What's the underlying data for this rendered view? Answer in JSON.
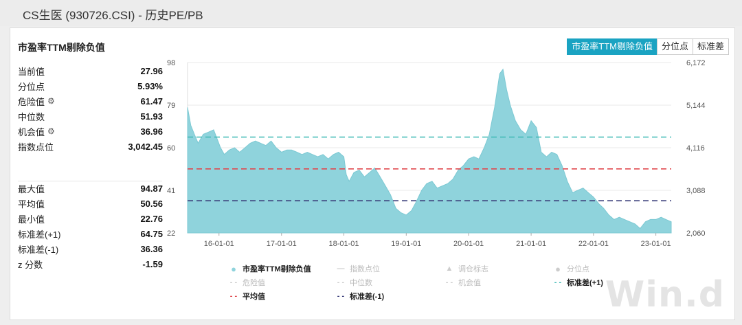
{
  "window": {
    "title": "CS生医 (930726.CSI) - 历史PE/PB"
  },
  "panel": {
    "title": "市盈率TTM剔除负值"
  },
  "tabs": [
    {
      "label": "市盈率TTM剔除负值",
      "active": true
    },
    {
      "label": "分位点",
      "active": false
    },
    {
      "label": "标准差",
      "active": false
    }
  ],
  "stats_top": [
    {
      "label": "当前值",
      "value": "27.96",
      "gear": false
    },
    {
      "label": "分位点",
      "value": "5.93%",
      "gear": false
    },
    {
      "label": "危险值",
      "value": "61.47",
      "gear": true
    },
    {
      "label": "中位数",
      "value": "51.93",
      "gear": false
    },
    {
      "label": "机会值",
      "value": "36.96",
      "gear": true
    },
    {
      "label": "指数点位",
      "value": "3,042.45",
      "gear": false
    }
  ],
  "stats_bottom": [
    {
      "label": "最大值",
      "value": "94.87"
    },
    {
      "label": "平均值",
      "value": "50.56"
    },
    {
      "label": "最小值",
      "value": "22.76"
    },
    {
      "label": "标准差(+1)",
      "value": "64.75"
    },
    {
      "label": "标准差(-1)",
      "value": "36.36"
    },
    {
      "label": "z 分数",
      "value": "-1.59"
    }
  ],
  "icons": {
    "gear": "gear-icon"
  },
  "watermark": "Win.d",
  "chart_data": {
    "type": "area",
    "x_start": "2015-07-01",
    "x_end": "2023-04-01",
    "xticks": [
      "16-01-01",
      "17-01-01",
      "18-01-01",
      "19-01-01",
      "20-01-01",
      "21-01-01",
      "22-01-01",
      "23-01-01"
    ],
    "xtick_dates": [
      "2016-01-01",
      "2017-01-01",
      "2018-01-01",
      "2019-01-01",
      "2020-01-01",
      "2021-01-01",
      "2022-01-01",
      "2023-01-01"
    ],
    "y_left": {
      "ticks": [
        "98",
        "79",
        "60",
        "41",
        "22"
      ],
      "range": [
        22,
        98
      ]
    },
    "y_right": {
      "ticks": [
        "6,172",
        "5,144",
        "4,116",
        "3,088",
        "2,060"
      ],
      "range": [
        2060,
        6172
      ]
    },
    "series": [
      {
        "name": "市盈率TTM剔除负值",
        "color": "#8fd3dc",
        "points": [
          [
            "2015-07-01",
            78
          ],
          [
            "2015-07-20",
            70
          ],
          [
            "2015-08-10",
            66
          ],
          [
            "2015-09-01",
            62
          ],
          [
            "2015-10-01",
            66
          ],
          [
            "2015-11-01",
            67
          ],
          [
            "2015-12-01",
            68
          ],
          [
            "2016-01-10",
            60
          ],
          [
            "2016-02-01",
            57
          ],
          [
            "2016-03-01",
            59
          ],
          [
            "2016-04-01",
            60
          ],
          [
            "2016-05-01",
            58
          ],
          [
            "2016-06-01",
            60
          ],
          [
            "2016-07-01",
            62
          ],
          [
            "2016-08-01",
            63
          ],
          [
            "2016-09-01",
            62
          ],
          [
            "2016-10-01",
            61
          ],
          [
            "2016-11-01",
            63
          ],
          [
            "2016-12-01",
            60
          ],
          [
            "2017-01-01",
            58
          ],
          [
            "2017-02-01",
            59
          ],
          [
            "2017-03-01",
            59
          ],
          [
            "2017-04-01",
            58
          ],
          [
            "2017-05-01",
            57
          ],
          [
            "2017-06-01",
            58
          ],
          [
            "2017-07-01",
            57
          ],
          [
            "2017-08-01",
            56
          ],
          [
            "2017-09-01",
            57
          ],
          [
            "2017-10-01",
            55
          ],
          [
            "2017-11-01",
            57
          ],
          [
            "2017-12-01",
            58
          ],
          [
            "2018-01-01",
            56
          ],
          [
            "2018-01-15",
            48
          ],
          [
            "2018-02-01",
            45
          ],
          [
            "2018-03-01",
            49
          ],
          [
            "2018-04-01",
            50
          ],
          [
            "2018-05-01",
            47
          ],
          [
            "2018-06-01",
            49
          ],
          [
            "2018-07-01",
            51
          ],
          [
            "2018-08-01",
            47
          ],
          [
            "2018-09-01",
            43
          ],
          [
            "2018-10-01",
            39
          ],
          [
            "2018-11-01",
            33
          ],
          [
            "2018-12-01",
            31
          ],
          [
            "2019-01-01",
            30
          ],
          [
            "2019-02-01",
            32
          ],
          [
            "2019-03-01",
            36
          ],
          [
            "2019-04-01",
            41
          ],
          [
            "2019-05-01",
            44
          ],
          [
            "2019-06-01",
            45
          ],
          [
            "2019-07-01",
            42
          ],
          [
            "2019-08-01",
            43
          ],
          [
            "2019-09-01",
            44
          ],
          [
            "2019-10-01",
            46
          ],
          [
            "2019-11-01",
            50
          ],
          [
            "2019-12-01",
            52
          ],
          [
            "2020-01-01",
            55
          ],
          [
            "2020-02-01",
            56
          ],
          [
            "2020-03-01",
            55
          ],
          [
            "2020-04-01",
            60
          ],
          [
            "2020-05-01",
            66
          ],
          [
            "2020-06-01",
            78
          ],
          [
            "2020-07-01",
            93
          ],
          [
            "2020-07-20",
            95
          ],
          [
            "2020-08-10",
            86
          ],
          [
            "2020-09-01",
            79
          ],
          [
            "2020-10-01",
            72
          ],
          [
            "2020-11-01",
            68
          ],
          [
            "2020-12-01",
            66
          ],
          [
            "2021-01-01",
            72
          ],
          [
            "2021-02-01",
            69
          ],
          [
            "2021-03-01",
            58
          ],
          [
            "2021-04-01",
            56
          ],
          [
            "2021-05-01",
            58
          ],
          [
            "2021-06-01",
            57
          ],
          [
            "2021-07-01",
            52
          ],
          [
            "2021-08-01",
            45
          ],
          [
            "2021-09-01",
            40
          ],
          [
            "2021-10-01",
            41
          ],
          [
            "2021-11-01",
            42
          ],
          [
            "2021-12-01",
            40
          ],
          [
            "2022-01-01",
            38
          ],
          [
            "2022-02-01",
            35
          ],
          [
            "2022-03-01",
            33
          ],
          [
            "2022-04-01",
            30
          ],
          [
            "2022-05-01",
            28
          ],
          [
            "2022-06-01",
            29
          ],
          [
            "2022-07-01",
            28
          ],
          [
            "2022-08-01",
            27
          ],
          [
            "2022-09-01",
            26
          ],
          [
            "2022-10-01",
            24
          ],
          [
            "2022-11-01",
            27
          ],
          [
            "2022-12-01",
            28
          ],
          [
            "2023-01-01",
            28
          ],
          [
            "2023-02-01",
            29
          ],
          [
            "2023-03-01",
            28
          ],
          [
            "2023-04-01",
            27
          ]
        ]
      }
    ],
    "reference_lines": [
      {
        "name": "标准差(+1)",
        "value": 64.75,
        "color": "#3bb8b4",
        "dash": "8,5"
      },
      {
        "name": "平均值",
        "value": 50.56,
        "color": "#e0474c",
        "dash": "8,5"
      },
      {
        "name": "标准差(-1)",
        "value": 36.36,
        "color": "#3a3e7a",
        "dash": "8,5"
      }
    ],
    "legend": [
      {
        "label": "市盈率TTM剔除负值",
        "symbol": "dot",
        "color": "#8fd3dc",
        "active": true
      },
      {
        "label": "指数点位",
        "symbol": "line",
        "color": "#cccccc",
        "active": false
      },
      {
        "label": "调仓标志",
        "symbol": "triangle",
        "color": "#cccccc",
        "active": false
      },
      {
        "label": "分位点",
        "symbol": "dot",
        "color": "#cccccc",
        "active": false
      },
      {
        "label": "危险值",
        "symbol": "dash",
        "color": "#cccccc",
        "active": false
      },
      {
        "label": "中位数",
        "symbol": "dash",
        "color": "#cccccc",
        "active": false
      },
      {
        "label": "机会值",
        "symbol": "dash",
        "color": "#cccccc",
        "active": false
      },
      {
        "label": "标准差(+1)",
        "symbol": "dash",
        "color": "#3bb8b4",
        "active": true
      },
      {
        "label": "平均值",
        "symbol": "dash",
        "color": "#e0474c",
        "active": true
      },
      {
        "label": "标准差(-1)",
        "symbol": "dash",
        "color": "#3a3e7a",
        "active": true
      }
    ],
    "grid": true,
    "legend_position": "bottom"
  }
}
